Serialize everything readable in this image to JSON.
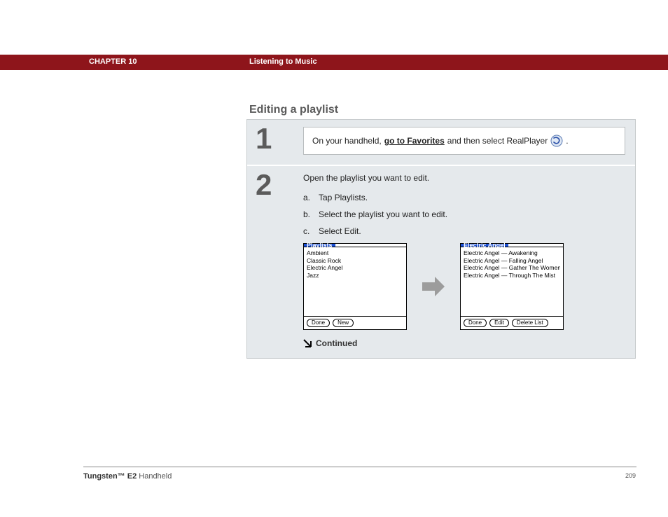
{
  "header": {
    "chapter": "CHAPTER 10",
    "section": "Listening to Music"
  },
  "title": "Editing a playlist",
  "step1": {
    "num": "1",
    "pre": "On your handheld, ",
    "link": "go to Favorites",
    "post": " and then select RealPlayer ",
    "tail": "."
  },
  "step2": {
    "num": "2",
    "intro": "Open the playlist you want to edit.",
    "a_letter": "a.",
    "a_text": "Tap Playlists.",
    "b_letter": "b.",
    "b_text": "Select the playlist you want to edit.",
    "c_letter": "c.",
    "c_text": "Select Edit.",
    "continued": "Continued"
  },
  "palm_left": {
    "title": "Playlists",
    "items": [
      "Ambient",
      "Classic Rock",
      "Electric Angel",
      "Jazz"
    ],
    "buttons": [
      "Done",
      "New"
    ]
  },
  "palm_right": {
    "title": "Electric Angel",
    "items": [
      "Electric Angel — Awakening",
      "Electric Angel — Falling Angel",
      "Electric Angel — Gather The Women",
      "Electric Angel — Through The Mist"
    ],
    "buttons": [
      "Done",
      "Edit",
      "Delete List"
    ]
  },
  "footer": {
    "brand": "Tungsten™ E2",
    "suffix": " Handheld",
    "page": "209"
  }
}
